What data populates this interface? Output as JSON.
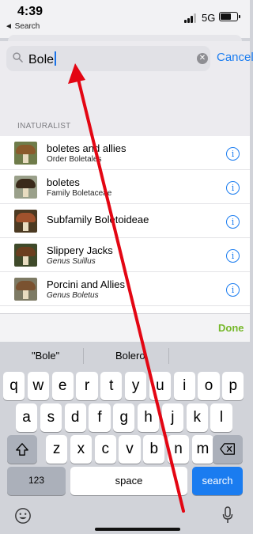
{
  "status": {
    "time": "4:39",
    "back_app": "◄ Search",
    "network": "5G"
  },
  "search": {
    "value": "Bole",
    "cancel_label": "Cancel",
    "clear_icon": "clear-circle-icon"
  },
  "section": {
    "header": "INATURALIST"
  },
  "results": [
    {
      "title": "boletes and allies",
      "subtitle": "Order Boletales",
      "italic": false,
      "cap": "#8a5a2b"
    },
    {
      "title": "boletes",
      "subtitle": "Family Boletaceae",
      "italic": false,
      "cap": "#3a2a1a"
    },
    {
      "title": "Subfamily Boletoideae",
      "subtitle": "",
      "italic": false,
      "cap": "#a0522d"
    },
    {
      "title": "Slippery Jacks",
      "subtitle": "Genus Suillus",
      "italic": true,
      "cap": "#6b3e1e"
    },
    {
      "title": "Porcini and Allies",
      "subtitle": "Genus Boletus",
      "italic": true,
      "cap": "#7a5230"
    }
  ],
  "toolbar": {
    "done_label": "Done"
  },
  "suggestions": [
    "\"Bole\"",
    "Bolero",
    ""
  ],
  "keyboard": {
    "row1": [
      "q",
      "w",
      "e",
      "r",
      "t",
      "y",
      "u",
      "i",
      "o",
      "p"
    ],
    "row2": [
      "a",
      "s",
      "d",
      "f",
      "g",
      "h",
      "j",
      "k",
      "l"
    ],
    "row3": [
      "z",
      "x",
      "c",
      "v",
      "b",
      "n",
      "m"
    ],
    "numbers_label": "123",
    "space_label": "space",
    "search_label": "search"
  },
  "colors": {
    "accent": "#1a7cf0",
    "done": "#76b82a",
    "annotation": "#e30613"
  }
}
